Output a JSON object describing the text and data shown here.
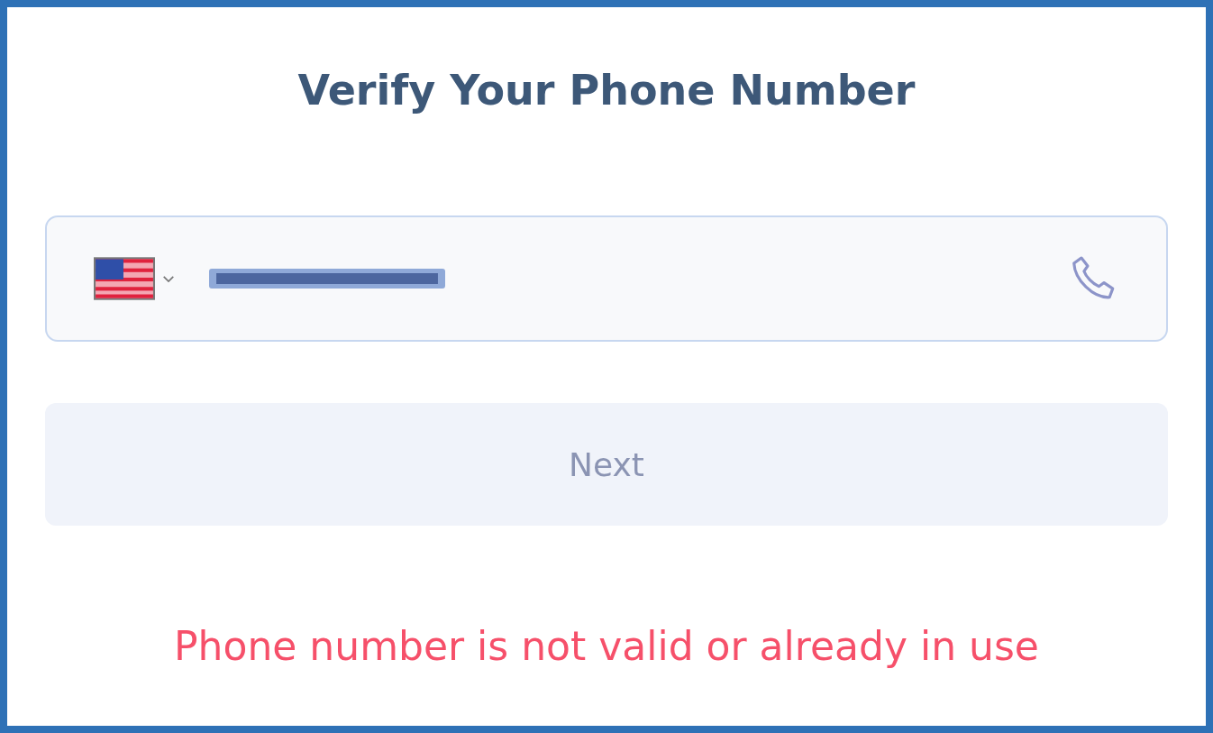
{
  "title": "Verify Your Phone Number",
  "phone_field": {
    "number_redacted": true
  },
  "next_button": {
    "label": "Next",
    "disabled": true
  },
  "error": "Phone number is not valid or already in use"
}
